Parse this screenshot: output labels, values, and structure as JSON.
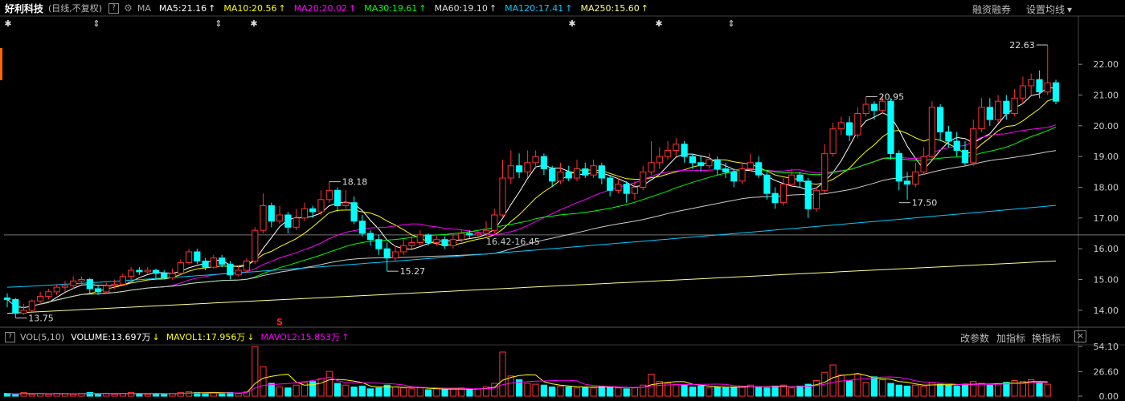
{
  "header": {
    "stock_name": "好利科技",
    "period": "(日线,不复权)",
    "help": "?",
    "ma_label": "MA",
    "ma_items": [
      {
        "text": "MA5:21.16",
        "arrow": "↑",
        "color": "#ffffff"
      },
      {
        "text": "MA10:20.56",
        "arrow": "↑",
        "color": "#ffff00"
      },
      {
        "text": "MA20:20.02",
        "arrow": "↑",
        "color": "#ff00ff"
      },
      {
        "text": "MA30:19.61",
        "arrow": "↑",
        "color": "#00ff00"
      },
      {
        "text": "MA60:19.10",
        "arrow": "↑",
        "color": "#dddddd"
      },
      {
        "text": "MA120:17.41",
        "arrow": "↑",
        "color": "#00ccff"
      },
      {
        "text": "MA250:15.60",
        "arrow": "↑",
        "color": "#ffff88"
      }
    ],
    "link_margin": "融资融券",
    "link_settings": "设置均线",
    "settings_chevron": "▾"
  },
  "volume_header": {
    "help": "?",
    "label": "VOL(5,10)",
    "items": [
      {
        "text": "VOLUME:13.697万",
        "arrow": "↓",
        "color": "#ffffff",
        "arrow_color": "#ffff00"
      },
      {
        "text": "MAVOL1:17.956万",
        "arrow": "↓",
        "color": "#ffff00",
        "arrow_color": "#ffff00"
      },
      {
        "text": "MAVOL2:15.853万",
        "arrow": "↑",
        "color": "#ff00ff",
        "arrow_color": "#ff00ff"
      }
    ],
    "btn_params": "改参数",
    "btn_add": "加指标",
    "btn_switch": "换指标",
    "close": "×"
  },
  "chart_data": {
    "type": "candlestick",
    "price_axis": {
      "ticks": [
        "22.00",
        "21.00",
        "20.00",
        "19.00",
        "18.00",
        "17.00",
        "16.00",
        "15.00",
        "14.00"
      ],
      "ylim": [
        13.5,
        23.1
      ]
    },
    "volume_axis": {
      "ticks": [
        "54.10",
        "26.60",
        "0.00"
      ],
      "ylim": [
        0,
        54.1
      ]
    },
    "annotations": {
      "high": "22.63",
      "low": "13.75",
      "peak1": "18.18",
      "dip1": "15.27",
      "peak2": "20.95",
      "dip2": "17.50",
      "level": "16.42-16.45",
      "signal": "S"
    },
    "reference_price": 16.45,
    "candles": [
      [
        14.4,
        14.35,
        14.55,
        14.1
      ],
      [
        14.35,
        13.9,
        14.4,
        13.75
      ],
      [
        13.9,
        14.0,
        14.2,
        13.85
      ],
      [
        14.0,
        14.3,
        14.35,
        13.95
      ],
      [
        14.3,
        14.45,
        14.6,
        14.2
      ],
      [
        14.45,
        14.6,
        14.7,
        14.35
      ],
      [
        14.6,
        14.75,
        14.85,
        14.5
      ],
      [
        14.75,
        14.8,
        14.95,
        14.6
      ],
      [
        14.8,
        14.95,
        15.1,
        14.7
      ],
      [
        14.95,
        15.0,
        15.1,
        14.85
      ],
      [
        15.0,
        14.7,
        15.05,
        14.55
      ],
      [
        14.7,
        14.6,
        14.8,
        14.5
      ],
      [
        14.6,
        14.8,
        14.9,
        14.55
      ],
      [
        14.8,
        14.85,
        15.0,
        14.7
      ],
      [
        14.85,
        15.1,
        15.2,
        14.8
      ],
      [
        15.1,
        15.3,
        15.4,
        15.0
      ],
      [
        15.3,
        15.25,
        15.4,
        15.15
      ],
      [
        15.25,
        15.3,
        15.4,
        15.2
      ],
      [
        15.3,
        15.2,
        15.35,
        15.0
      ],
      [
        15.2,
        15.05,
        15.3,
        15.0
      ],
      [
        15.05,
        15.2,
        15.35,
        15.0
      ],
      [
        15.2,
        15.55,
        15.65,
        15.15
      ],
      [
        15.55,
        15.9,
        16.0,
        15.5
      ],
      [
        15.9,
        15.6,
        16.0,
        15.5
      ],
      [
        15.6,
        15.4,
        15.7,
        15.3
      ],
      [
        15.4,
        15.7,
        15.8,
        15.35
      ],
      [
        15.7,
        15.5,
        15.8,
        15.4
      ],
      [
        15.5,
        15.15,
        15.6,
        15.0
      ],
      [
        15.15,
        15.3,
        15.45,
        15.1
      ],
      [
        15.3,
        15.6,
        15.7,
        15.2
      ],
      [
        15.6,
        16.6,
        16.7,
        15.5
      ],
      [
        16.6,
        17.4,
        17.8,
        16.5
      ],
      [
        17.4,
        16.9,
        17.5,
        16.7
      ],
      [
        16.9,
        17.1,
        17.4,
        16.8
      ],
      [
        17.1,
        16.7,
        17.2,
        16.5
      ],
      [
        16.7,
        17.0,
        17.3,
        16.6
      ],
      [
        17.0,
        17.3,
        17.5,
        16.9
      ],
      [
        17.3,
        17.2,
        17.4,
        17.0
      ],
      [
        17.2,
        17.6,
        17.9,
        17.1
      ],
      [
        17.6,
        17.9,
        18.18,
        17.5
      ],
      [
        17.9,
        17.4,
        18.0,
        17.2
      ],
      [
        17.4,
        17.5,
        17.9,
        17.3
      ],
      [
        17.5,
        16.9,
        17.7,
        16.8
      ],
      [
        16.9,
        16.5,
        17.1,
        16.4
      ],
      [
        16.5,
        16.3,
        16.6,
        16.1
      ],
      [
        16.3,
        16.0,
        16.45,
        15.8
      ],
      [
        16.0,
        15.7,
        16.2,
        15.27
      ],
      [
        15.7,
        15.9,
        16.1,
        15.6
      ],
      [
        15.9,
        16.1,
        16.3,
        15.8
      ],
      [
        16.1,
        16.2,
        16.4,
        16.0
      ],
      [
        16.2,
        16.45,
        16.6,
        16.1
      ],
      [
        16.45,
        16.2,
        16.5,
        16.1
      ],
      [
        16.2,
        16.3,
        16.45,
        16.1
      ],
      [
        16.3,
        16.1,
        16.4,
        16.0
      ],
      [
        16.1,
        16.3,
        16.5,
        16.0
      ],
      [
        16.3,
        16.5,
        16.6,
        16.2
      ],
      [
        16.5,
        16.45,
        16.6,
        16.35
      ],
      [
        16.45,
        16.5,
        16.6,
        16.4
      ],
      [
        16.5,
        16.6,
        16.9,
        16.4
      ],
      [
        16.6,
        17.1,
        17.3,
        16.5
      ],
      [
        17.1,
        18.3,
        18.9,
        17.0
      ],
      [
        18.3,
        18.7,
        19.2,
        18.1
      ],
      [
        18.7,
        18.5,
        19.1,
        18.3
      ],
      [
        18.5,
        18.8,
        19.2,
        18.3
      ],
      [
        18.8,
        19.0,
        19.2,
        18.6
      ],
      [
        19.0,
        18.6,
        19.1,
        18.4
      ],
      [
        18.6,
        18.2,
        18.7,
        18.0
      ],
      [
        18.2,
        18.5,
        18.8,
        18.1
      ],
      [
        18.5,
        18.3,
        18.7,
        18.2
      ],
      [
        18.3,
        18.6,
        18.9,
        18.2
      ],
      [
        18.6,
        18.4,
        18.8,
        18.3
      ],
      [
        18.4,
        18.7,
        18.9,
        18.3
      ],
      [
        18.7,
        18.3,
        18.8,
        18.1
      ],
      [
        18.3,
        17.9,
        18.4,
        17.7
      ],
      [
        17.9,
        18.1,
        18.3,
        17.8
      ],
      [
        18.1,
        17.8,
        18.2,
        17.5
      ],
      [
        17.8,
        18.0,
        18.2,
        17.6
      ],
      [
        18.0,
        18.5,
        18.7,
        17.9
      ],
      [
        18.5,
        18.8,
        19.5,
        18.4
      ],
      [
        18.8,
        19.0,
        19.3,
        18.6
      ],
      [
        19.0,
        19.2,
        19.5,
        18.9
      ],
      [
        19.2,
        19.4,
        19.6,
        19.0
      ],
      [
        19.4,
        19.0,
        19.5,
        18.8
      ],
      [
        19.0,
        18.8,
        19.1,
        18.6
      ],
      [
        18.8,
        18.7,
        19.0,
        18.5
      ],
      [
        18.7,
        18.9,
        19.1,
        18.6
      ],
      [
        18.9,
        18.6,
        19.0,
        18.4
      ],
      [
        18.6,
        18.5,
        18.8,
        18.3
      ],
      [
        18.5,
        18.2,
        18.6,
        18.0
      ],
      [
        18.2,
        18.6,
        18.8,
        18.1
      ],
      [
        18.6,
        18.8,
        19.1,
        18.5
      ],
      [
        18.8,
        18.4,
        19.0,
        18.3
      ],
      [
        18.4,
        17.8,
        18.5,
        17.6
      ],
      [
        17.8,
        17.5,
        18.0,
        17.3
      ],
      [
        17.5,
        18.1,
        18.3,
        17.4
      ],
      [
        18.1,
        18.4,
        18.6,
        18.0
      ],
      [
        18.4,
        18.2,
        18.5,
        18.0
      ],
      [
        18.2,
        17.3,
        18.3,
        17.0
      ],
      [
        17.3,
        17.9,
        18.0,
        17.2
      ],
      [
        17.9,
        19.1,
        19.4,
        17.8
      ],
      [
        19.1,
        19.9,
        20.1,
        19.0
      ],
      [
        19.9,
        20.1,
        20.3,
        19.7
      ],
      [
        20.1,
        19.7,
        20.3,
        19.5
      ],
      [
        19.7,
        20.4,
        20.6,
        19.6
      ],
      [
        20.4,
        20.7,
        20.95,
        20.3
      ],
      [
        20.7,
        20.5,
        20.8,
        20.2
      ],
      [
        20.5,
        20.8,
        21.0,
        20.4
      ],
      [
        20.8,
        19.1,
        20.9,
        18.9
      ],
      [
        19.1,
        18.2,
        19.2,
        17.9
      ],
      [
        18.2,
        18.1,
        18.5,
        17.6
      ],
      [
        18.1,
        18.5,
        18.8,
        18.0
      ],
      [
        18.5,
        19.0,
        19.3,
        18.4
      ],
      [
        19.0,
        20.6,
        20.8,
        18.9
      ],
      [
        20.6,
        19.8,
        20.7,
        19.5
      ],
      [
        19.8,
        19.5,
        20.0,
        19.3
      ],
      [
        19.5,
        19.2,
        19.8,
        19.0
      ],
      [
        19.2,
        18.8,
        19.5,
        18.7
      ],
      [
        18.8,
        19.9,
        20.2,
        18.7
      ],
      [
        19.9,
        20.6,
        20.9,
        19.8
      ],
      [
        20.6,
        20.2,
        20.9,
        20.0
      ],
      [
        20.2,
        20.8,
        21.0,
        20.1
      ],
      [
        20.8,
        20.4,
        21.0,
        20.2
      ],
      [
        20.4,
        20.9,
        21.2,
        20.3
      ],
      [
        20.9,
        21.3,
        21.6,
        20.7
      ],
      [
        21.3,
        21.5,
        21.7,
        21.0
      ],
      [
        21.5,
        21.1,
        21.8,
        20.9
      ],
      [
        21.1,
        21.4,
        22.63,
        21.0
      ],
      [
        21.4,
        20.8,
        21.5,
        20.7
      ]
    ],
    "volumes": [
      3,
      2,
      4,
      2,
      3,
      2,
      3,
      3,
      2,
      3,
      4,
      2,
      3,
      2,
      3,
      4,
      3,
      2,
      3,
      2,
      3,
      4,
      5,
      4,
      3,
      4,
      3,
      4,
      3,
      5,
      54,
      32,
      14,
      10,
      9,
      12,
      15,
      16,
      19,
      27,
      14,
      12,
      10,
      11,
      8,
      9,
      12,
      10,
      9,
      8,
      9,
      7,
      8,
      7,
      8,
      9,
      7,
      8,
      10,
      14,
      48,
      22,
      18,
      14,
      13,
      12,
      10,
      11,
      10,
      9,
      10,
      9,
      11,
      10,
      9,
      8,
      9,
      12,
      24,
      16,
      14,
      13,
      12,
      10,
      11,
      9,
      10,
      9,
      10,
      11,
      12,
      10,
      9,
      11,
      12,
      9,
      11,
      13,
      17,
      26,
      34,
      23,
      17,
      24,
      15,
      21,
      18,
      14,
      12,
      11,
      12,
      11,
      15,
      13,
      12,
      11,
      13,
      16,
      14,
      12,
      13,
      15,
      17,
      16,
      18,
      14,
      13
    ]
  }
}
